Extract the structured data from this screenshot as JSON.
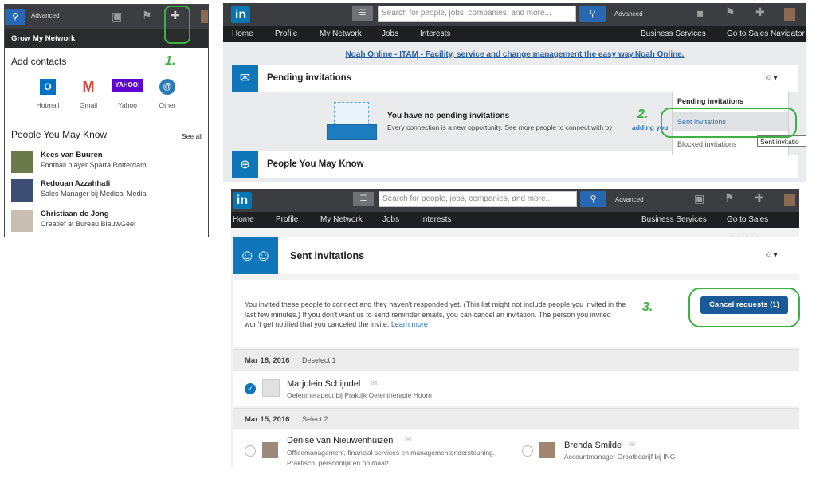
{
  "panel1": {
    "advanced": "Advanced",
    "grow_title": "Grow My Network",
    "add_contacts": "Add contacts",
    "providers": [
      {
        "label": "Hotmail",
        "icon": "outlook-icon",
        "color": "#0072c6"
      },
      {
        "label": "Gmail",
        "icon": "gmail-icon",
        "color": "#d44638"
      },
      {
        "label": "Yahoo",
        "icon": "yahoo-icon",
        "color": "#5f01d1"
      },
      {
        "label": "Other",
        "icon": "at-icon",
        "color": "#2a7ab9"
      }
    ],
    "pymk_title": "People You May Know",
    "see_all": "See all",
    "people": [
      {
        "name": "Kees van Buuren",
        "sub": "Football player Sparta Rotterdam"
      },
      {
        "name": "Redouan Azzahhafi",
        "sub": "Sales Manager bij Medical Media"
      },
      {
        "name": "Christiaan de Jong",
        "sub": "Creatief at Bureau BlauwGeel"
      }
    ],
    "step": "1.",
    "yahoo_logo": "YAHOO!"
  },
  "panel2": {
    "logo": "in",
    "search_placeholder": "Search for people, jobs, companies, and more...",
    "advanced": "Advanced",
    "nav": {
      "home": "Home",
      "profile": "Profile",
      "my_network": "My Network",
      "jobs": "Jobs",
      "interests": "Interests",
      "business": "Business Services",
      "sales": "Go to Sales Navigator"
    },
    "ad_text": "Noah Online - ITAM - Facility, service and change management the easy way.Noah Online.",
    "pending_title": "Pending invitations",
    "no_pending": "You have no pending invitations",
    "no_pending_sub": "Every connection is a new opportunity. See more people to connect with by",
    "adding_link": "adding you",
    "dropdown": [
      "Pending invitations",
      "Sent invitations",
      "Blocked invitations"
    ],
    "tooltip": "Sent invitatio",
    "pymk": "People You May Know",
    "step": "2."
  },
  "panel3": {
    "logo": "in",
    "search_placeholder": "Search for people, jobs, companies, and more...",
    "advanced": "Advanced",
    "nav": {
      "home": "Home",
      "profile": "Profile",
      "my_network": "My Network",
      "jobs": "Jobs",
      "interests": "Interests",
      "business": "Business Services",
      "sales": "Go to Sales Navigator"
    },
    "sent_title": "Sent invitations",
    "info_text": "You invited these people to connect and they haven't responded yet. (This list might not include people you invited in the last few minutes.) If you don't want us to send reminder emails, you can cancel an invitation. The person you invited won't get notified that you canceled the invite.",
    "learn_more": "Learn more",
    "cancel_btn": "Cancel requests (1)",
    "step": "3.",
    "groups": [
      {
        "date": "Mar 18, 2016",
        "action": "Deselect 1"
      },
      {
        "date": "Mar 15, 2016",
        "action": "Select 2"
      }
    ],
    "invites": [
      {
        "name": "Marjolein Schijndel",
        "sub": "Oefentherapeut bij Praktijk Oefentherapie Hoorn"
      },
      {
        "name": "Denise van Nieuwenhuizen",
        "sub": "Officemanagement, financial services en managementondersteuning. Praktisch, persoonlijk en op maat!"
      },
      {
        "name": "Brenda Smilde",
        "sub": "Accountmanager Grootbedrijf bij ING"
      }
    ]
  }
}
